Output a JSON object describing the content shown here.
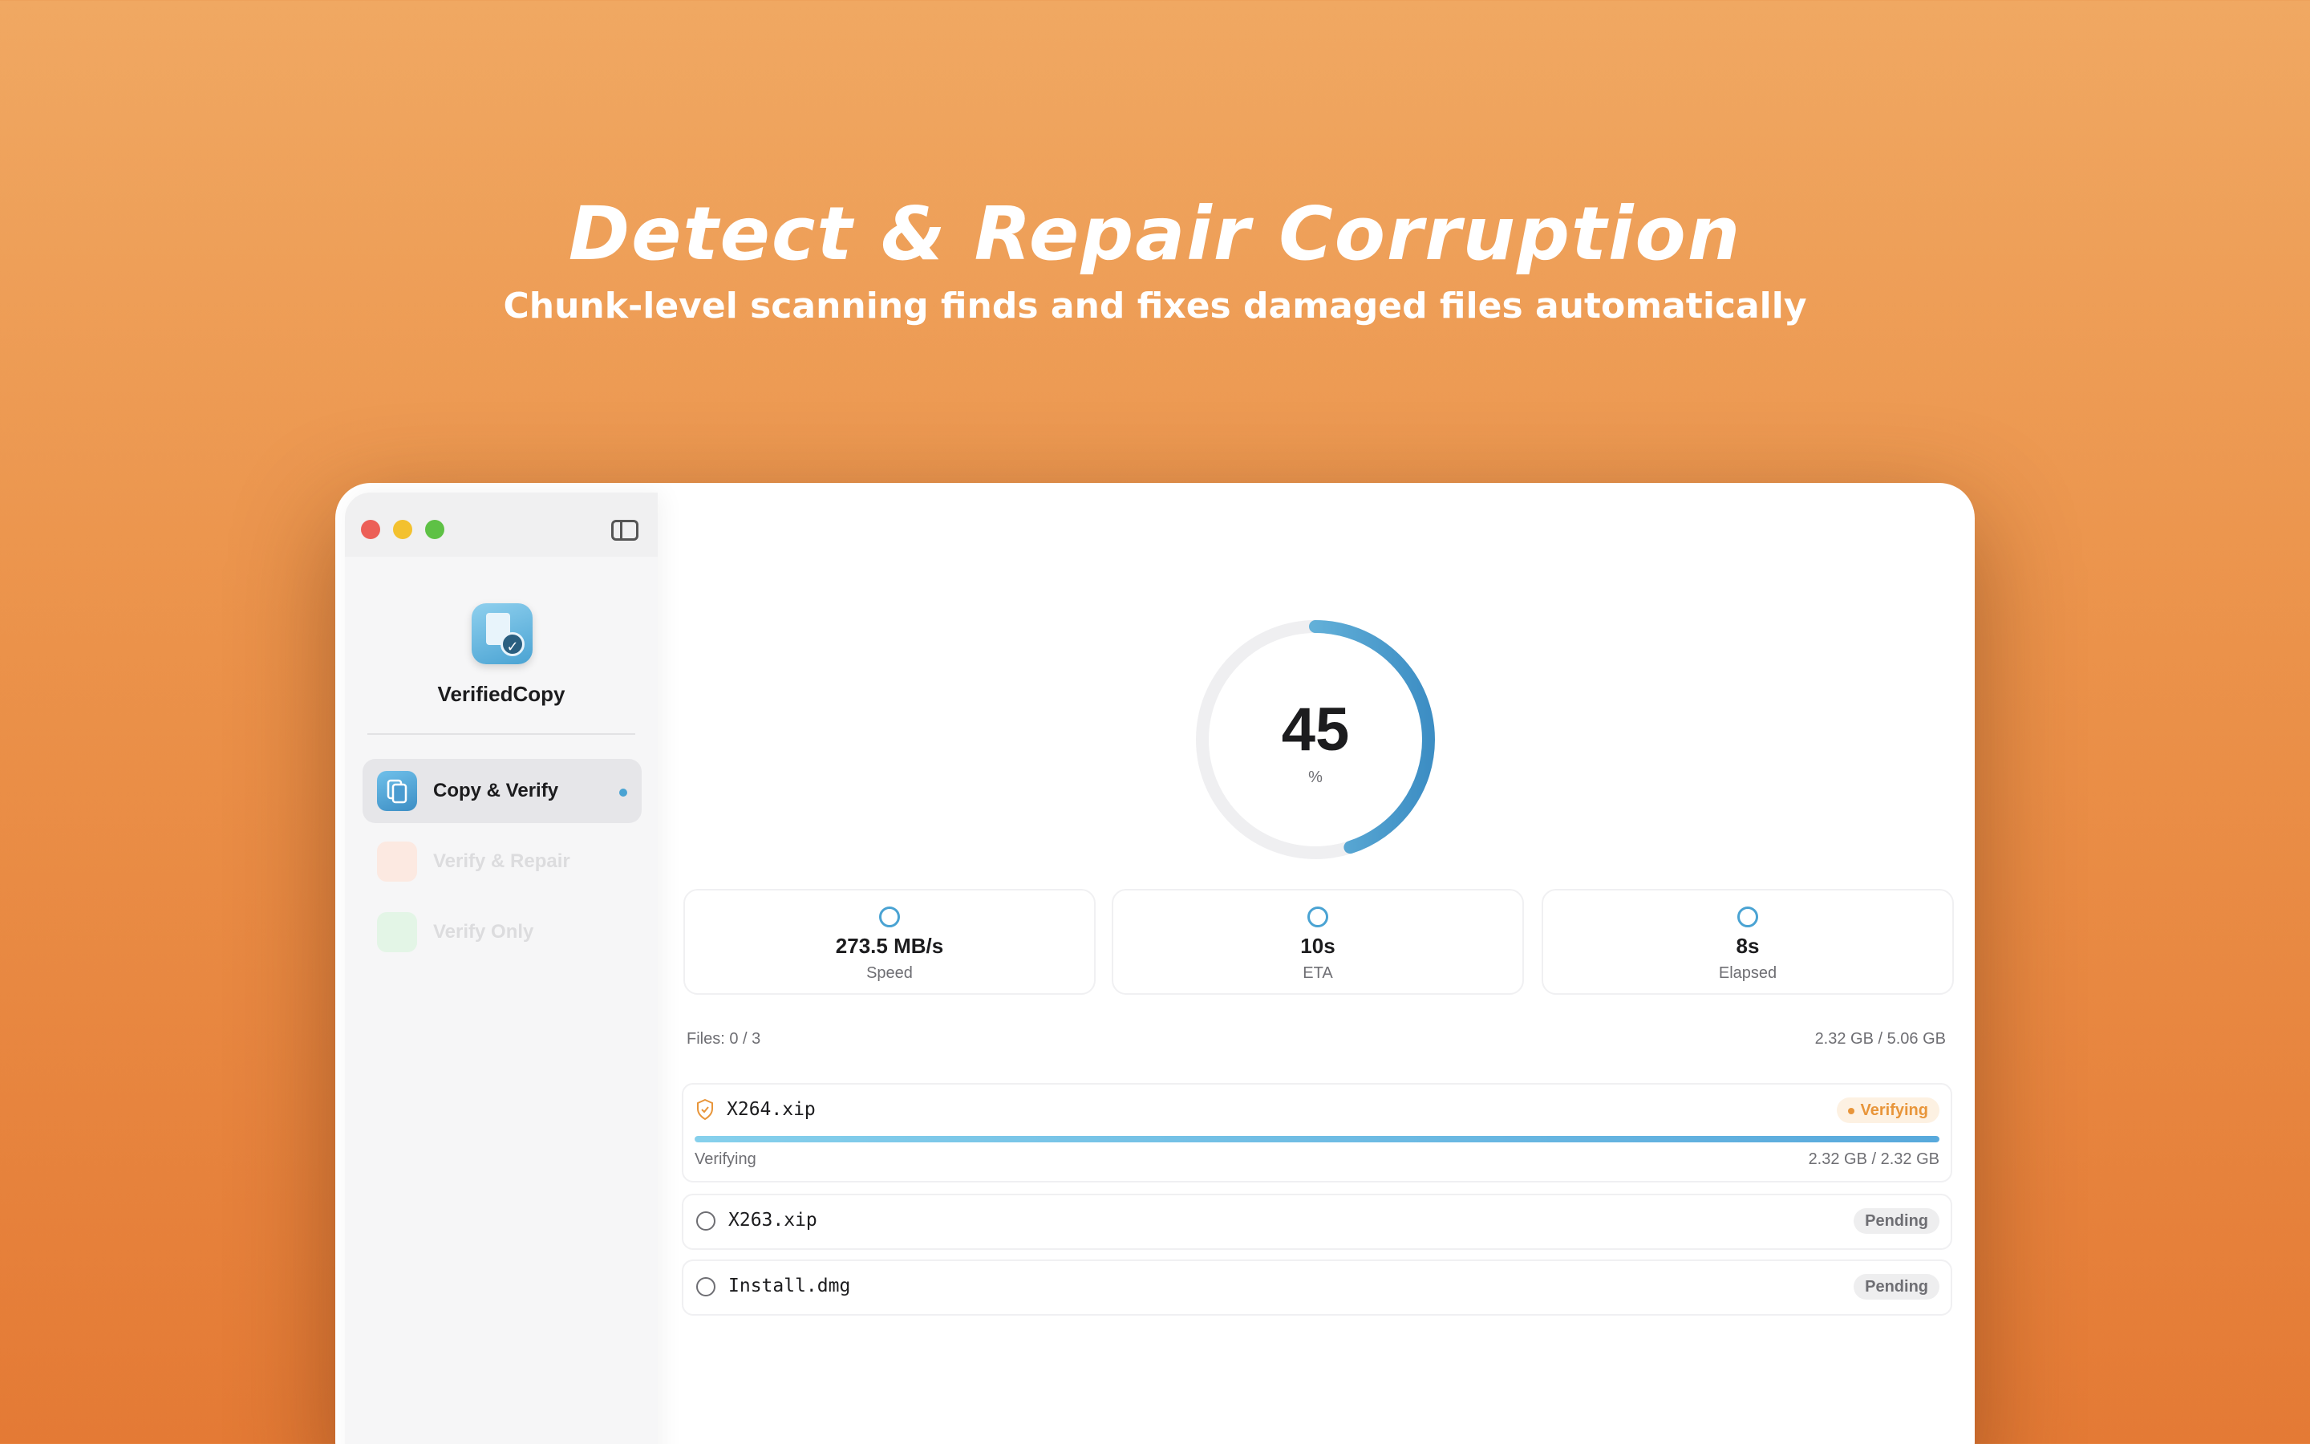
{
  "hero": {
    "title": "Detect & Repair Corruption",
    "subtitle": "Chunk-level scanning finds and fixes damaged files automatically"
  },
  "colors": {
    "accent": "#4aa3d3",
    "warning": "#e8953a",
    "background_top": "#f0a862",
    "background_bottom": "#e47a35"
  },
  "window": {
    "controls": [
      "close",
      "minimize",
      "maximize"
    ],
    "sidebar_toggle_icon": "sidebar-toggle-icon"
  },
  "sidebar": {
    "app_name": "VerifiedCopy",
    "app_icon": "verified-copy-app-icon",
    "items": [
      {
        "label": "Copy & Verify",
        "icon": "copy-verify-icon",
        "active": true,
        "color": "#4aa3d3"
      },
      {
        "label": "Verify & Repair",
        "icon": "verify-repair-icon",
        "active": false,
        "color": "#f3a98a"
      },
      {
        "label": "Verify Only",
        "icon": "verify-only-icon",
        "active": false,
        "color": "#9ad9a4"
      }
    ]
  },
  "progress": {
    "value": "45",
    "unit": "%",
    "fraction": 0.45
  },
  "stats": [
    {
      "value": "273.5 MB/s",
      "label": "Speed",
      "icon": "speedometer-icon"
    },
    {
      "value": "10s",
      "label": "ETA",
      "icon": "clock-icon"
    },
    {
      "value": "8s",
      "label": "Elapsed",
      "icon": "timer-icon"
    }
  ],
  "files_summary": {
    "count": "Files: 0 / 3",
    "size": "2.32 GB / 5.06 GB"
  },
  "files": [
    {
      "name": "X264.xip",
      "status": "Verifying",
      "icon": "shield-icon",
      "progress_label": "Verifying",
      "progress_size": "2.32 GB / 2.32 GB",
      "progress_fraction": 1.0
    },
    {
      "name": "X263.xip",
      "status": "Pending",
      "icon": "circle-icon"
    },
    {
      "name": "Install.dmg",
      "status": "Pending",
      "icon": "circle-icon"
    }
  ]
}
